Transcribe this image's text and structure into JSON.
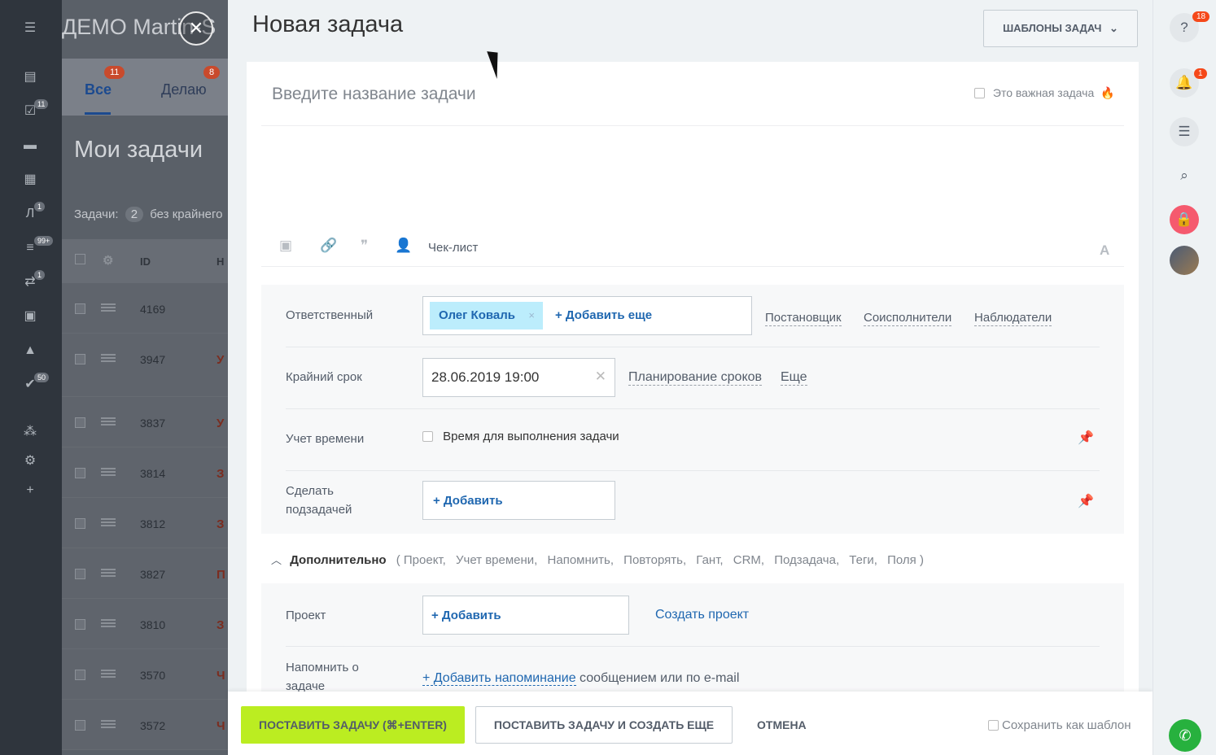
{
  "background": {
    "app_title": "ДЕМО Martin-S",
    "tabs": [
      {
        "label": "Все",
        "badge": "11"
      },
      {
        "label": "Делаю",
        "badge": "8"
      }
    ],
    "heading": "Мои задачи",
    "filter_prefix": "Задачи:",
    "filter_count": "2",
    "filter_suffix": "без крайнего",
    "columns": {
      "id": "ID",
      "name": "Н"
    },
    "rows": [
      {
        "id": "4169",
        "name": ""
      },
      {
        "id": "3947",
        "name": "У"
      },
      {
        "id": "3837",
        "name": "У"
      },
      {
        "id": "3814",
        "name": "З"
      },
      {
        "id": "3812",
        "name": "З"
      },
      {
        "id": "3827",
        "name": "П"
      },
      {
        "id": "3810",
        "name": "З"
      },
      {
        "id": "3570",
        "name": "Ч"
      },
      {
        "id": "3572",
        "name": "Ч"
      }
    ],
    "nav_badges": [
      "11",
      "1",
      "99+",
      "1",
      "50"
    ]
  },
  "slider": {
    "title": "Новая задача",
    "templates_button": "ШАБЛОНЫ ЗАДАЧ",
    "task_title_placeholder": "Введите название задачи",
    "important_label": "Это важная задача",
    "checklist_label": "Чек-лист",
    "fields": {
      "responsible": {
        "label": "Ответственный",
        "tag": "Олег Коваль",
        "add_more": "+ Добавить еще",
        "links": [
          "Постановщик",
          "Соисполнители",
          "Наблюдатели"
        ]
      },
      "deadline": {
        "label": "Крайний срок",
        "value": "28.06.2019 19:00",
        "links": [
          "Планирование сроков",
          "Еще"
        ]
      },
      "time_tracking": {
        "label": "Учет времени",
        "checkbox_label": "Время для выполнения задачи"
      },
      "subtask": {
        "label_line1": "Сделать",
        "label_line2": "подзадачей",
        "add": "+ Добавить"
      }
    },
    "additional": {
      "label": "Дополнительно",
      "items": [
        "( Проект,",
        "Учет времени,",
        "Напомнить,",
        "Повторять,",
        "Гант,",
        "CRM,",
        "Подзадача,",
        "Теги,",
        "Поля )"
      ]
    },
    "project": {
      "label": "Проект",
      "add": "+ Добавить",
      "create_link": "Создать проект"
    },
    "remind": {
      "label_line1": "Напомнить о",
      "label_line2": "задаче",
      "link": "+ Добавить напоминание",
      "suffix": " сообщением или по e-mail"
    },
    "footer": {
      "submit": "ПОСТАВИТЬ ЗАДАЧУ (⌘+ENTER)",
      "submit_and_create": "ПОСТАВИТЬ ЗАДАЧУ И СОЗДАТЬ ЕЩЕ",
      "cancel": "ОТМЕНА",
      "save_template": "Сохранить как шаблон"
    }
  },
  "rail": {
    "help_badge": "18",
    "notifications_badge": "1"
  },
  "colors": {
    "accent_green": "#bbed21",
    "link_blue": "#1f67b0",
    "badge_red": "#f54819"
  }
}
